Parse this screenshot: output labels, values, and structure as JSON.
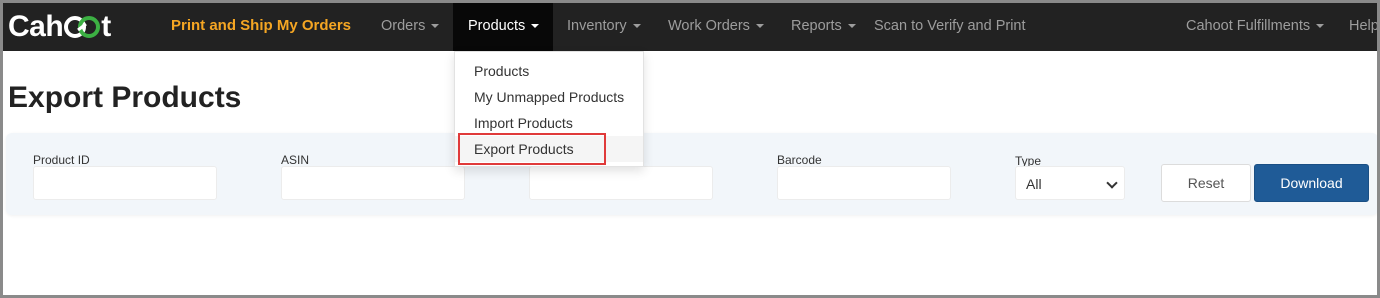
{
  "navbar": {
    "brand_left": "Cah",
    "brand_right": "t",
    "print_label": "Print and Ship My Orders",
    "orders_label": "Orders",
    "products_label": "Products",
    "inventory_label": "Inventory",
    "work_orders_label": "Work Orders",
    "reports_label": "Reports",
    "scan_label": "Scan to Verify and Print",
    "account_label": "Cahoot Fulfillments",
    "help_label": "Help"
  },
  "products_menu": {
    "items": [
      {
        "label": "Products"
      },
      {
        "label": "My Unmapped Products"
      },
      {
        "label": "Import Products"
      },
      {
        "label": "Export Products",
        "highlighted": true
      }
    ]
  },
  "page": {
    "title": "Export Products"
  },
  "filters": {
    "product_id_label": "Product ID",
    "product_id_value": "",
    "asin_label": "ASIN",
    "asin_value": "",
    "third_value": "",
    "barcode_label": "Barcode",
    "barcode_value": "",
    "type_label": "Type",
    "type_value": "All",
    "reset_label": "Reset",
    "download_label": "Download"
  },
  "colors": {
    "navbar_bg": "#222222",
    "print_accent": "#f5a623",
    "download_bg": "#1f5b97",
    "highlight_border": "#e03a3a",
    "brand_link": "#3cb043"
  },
  "icons": [
    "caret-down-icon",
    "chevron-down-icon",
    "brand-link-icon"
  ]
}
